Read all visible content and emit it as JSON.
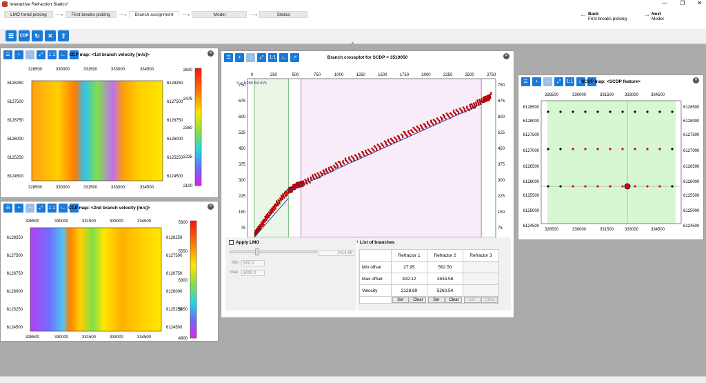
{
  "app": {
    "title": "Interactive Refraction Statics*"
  },
  "steps": [
    "LMO trend picking",
    "First breaks picking",
    "Branch assignment",
    "Model",
    "Statics"
  ],
  "active_step": 2,
  "back": {
    "label": "Back",
    "sub": "First breaks picking"
  },
  "next": {
    "label": "Next",
    "sub": "Model"
  },
  "toolbar": {
    "cdp_label": "CDP"
  },
  "panels": {
    "cdp1": {
      "title": "CDP map:  <1st branch velocity [m/s]>",
      "x_ticks_top": [
        "328500",
        "330000",
        "331500",
        "333000",
        "334500"
      ],
      "x_ticks_bottom": [
        "328500",
        "330000",
        "331500",
        "333000",
        "334500"
      ],
      "y_ticks_left": [
        "6128250",
        "6127500",
        "6126750",
        "6126000",
        "6125250",
        "6124500"
      ],
      "y_ticks_right": [
        "6128250",
        "6127500",
        "6126750",
        "6126000",
        "6125250",
        "6124500"
      ],
      "colorbar": [
        "2600",
        "2475",
        "2350",
        "2225",
        "2100"
      ]
    },
    "cdp2": {
      "title": "CDP map:  <2nd branch velocity [m/s]>",
      "x_ticks_top": [
        "328500",
        "330000",
        "331500",
        "333000",
        "334500"
      ],
      "x_ticks_bottom": [
        "328500",
        "330000",
        "331500",
        "333000",
        "334500"
      ],
      "y_ticks_left": [
        "6128250",
        "6127500",
        "6126750",
        "6126000",
        "6125250",
        "6124500"
      ],
      "y_ticks_right": [
        "6128250",
        "6127500",
        "6126750",
        "6126000",
        "6125250",
        "6124500"
      ],
      "colorbar": [
        "5800",
        "5550",
        "5300",
        "5050",
        "4800"
      ]
    },
    "crossplot": {
      "title": "Branch crossplot for SCDP = 3510050",
      "velocity_label": "V = 5260.54 m/s"
    },
    "scdp": {
      "title": "SCDP map:  <SCDP feature>",
      "x_ticks_top": [
        "328500",
        "330000",
        "331500",
        "333000",
        "334500"
      ],
      "x_ticks_bottom": [
        "328500",
        "330000",
        "331500",
        "333000",
        "334500"
      ],
      "y_ticks_left": [
        "6128500",
        "6128000",
        "6127500",
        "6127000",
        "6126500",
        "6126000",
        "6125500",
        "6125000",
        "6124500"
      ],
      "y_ticks_right": [
        "6128500",
        "6128000",
        "6127500",
        "6127000",
        "6126500",
        "6126000",
        "6125500",
        "6125000",
        "6124500"
      ]
    }
  },
  "chart_data": {
    "type": "scatter",
    "title": "Branch crossplot for SCDP = 3510050",
    "x_ticks": [
      "0",
      "250",
      "500",
      "750",
      "1000",
      "1250",
      "1500",
      "1750",
      "2000",
      "2250",
      "2500",
      "2750"
    ],
    "y_ticks": [
      "750",
      "675",
      "600",
      "525",
      "450",
      "375",
      "300",
      "225",
      "150",
      "75"
    ],
    "xlim": [
      -50,
      2800
    ],
    "ylim": [
      30,
      780
    ],
    "branch_bounds": [
      27.95,
      419.12,
      562.5,
      2634.58
    ],
    "fit_lines": [
      {
        "name": "Refractor 1",
        "x": [
          27.95,
          419.12
        ],
        "y": [
          30,
          215
        ]
      },
      {
        "name": "Refractor 2",
        "x": [
          419.12,
          2634.58
        ],
        "y": [
          250,
          660
        ]
      }
    ],
    "series": [
      {
        "x": [
          30,
          100,
          200,
          300,
          419,
          500,
          600,
          800,
          1000,
          1250,
          1500,
          1750,
          2000,
          2250,
          2500,
          2650,
          2750
        ],
        "y": [
          40,
          85,
          140,
          195,
          250,
          270,
          290,
          330,
          375,
          420,
          465,
          515,
          560,
          605,
          645,
          675,
          700
        ]
      }
    ]
  },
  "lmo": {
    "label": "Apply LMO",
    "value": "2414.89",
    "min_label": "Min:",
    "min_value": "500.0",
    "max_label": "Max:",
    "max_value": "5000.0"
  },
  "branches": {
    "title": "List of branches",
    "headers": [
      "Refractor 1",
      "Refractor 2",
      "Refractor 3"
    ],
    "rows": [
      {
        "label": "Min offset",
        "values": [
          "27.95",
          "562.50",
          ""
        ]
      },
      {
        "label": "Max offset",
        "values": [
          "419.12",
          "2634.58",
          ""
        ]
      },
      {
        "label": "Velocity",
        "values": [
          "2128.69",
          "5260.54",
          ""
        ]
      }
    ],
    "set_label": "Set",
    "clear_label": "Clear"
  },
  "colors": {
    "accent": "#1a7ad8",
    "scatter": "#b30000",
    "fit": "#2244aa",
    "branch1_bg": "#eaf6e6",
    "branch2_bg": "#f7ecf7",
    "scdp_bg": "#d7f7d2"
  }
}
